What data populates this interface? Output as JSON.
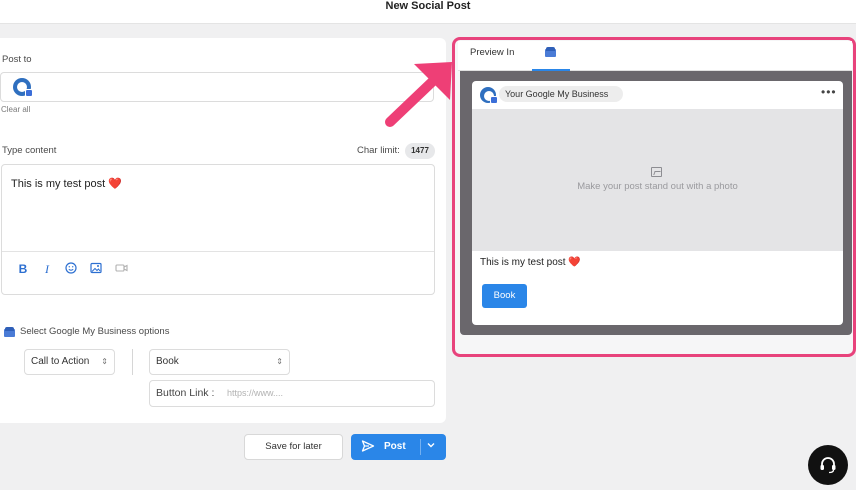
{
  "header": {
    "title": "New Social Post"
  },
  "compose": {
    "post_to_label": "Post to",
    "clear_all": "Clear all",
    "type_content_label": "Type content",
    "char_limit_label": "Char limit:",
    "char_limit_value": "1477",
    "content_text": "This is my test post",
    "content_emoji": "❤️",
    "toolbar_icons": [
      "bold-icon",
      "italic-icon",
      "emoji-icon",
      "image-icon",
      "video-icon"
    ]
  },
  "gmb_options": {
    "label": "Select Google My Business options",
    "action_type": "Call to Action",
    "action_value": "Book",
    "button_link_label": "Button Link :",
    "button_link_placeholder": "https://www...."
  },
  "actions": {
    "save_label": "Save for later",
    "post_label": "Post"
  },
  "preview": {
    "tab_label": "Preview In",
    "account_name": "Your Google My Business",
    "more_icon": "•••",
    "photo_prompt": "Make your post stand out with a photo",
    "post_text": "This is my test post",
    "post_emoji": "❤️",
    "book_button": "Book"
  },
  "colors": {
    "accent": "#2a86e8",
    "highlight": "#e8437c",
    "preview_bg": "#6a676c"
  }
}
